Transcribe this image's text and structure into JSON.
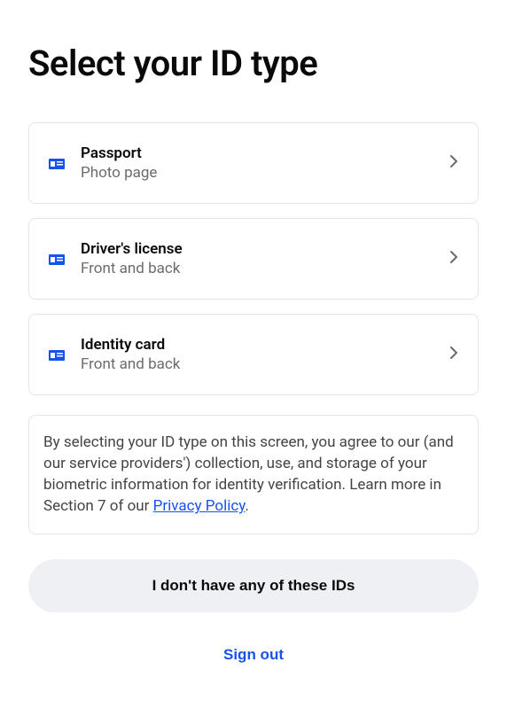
{
  "page": {
    "title": "Select your ID type"
  },
  "idOptions": [
    {
      "title": "Passport",
      "subtitle": "Photo page"
    },
    {
      "title": "Driver's license",
      "subtitle": "Front and back"
    },
    {
      "title": "Identity card",
      "subtitle": "Front and back"
    }
  ],
  "disclosure": {
    "text_before_link": "By selecting your ID type on this screen, you agree to our (and our service providers') collection, use, and storage of your biometric information for identity verification. Learn more in Section 7 of our ",
    "link_text": "Privacy Policy",
    "text_after_link": "."
  },
  "buttons": {
    "no_id_label": "I don't have any of these IDs",
    "sign_out_label": "Sign out"
  },
  "colors": {
    "accent": "#1652f0",
    "border": "#e5e5e5",
    "text_primary": "#0a0a0a",
    "text_secondary": "#6b6b6b",
    "button_bg": "#eef0f3"
  }
}
